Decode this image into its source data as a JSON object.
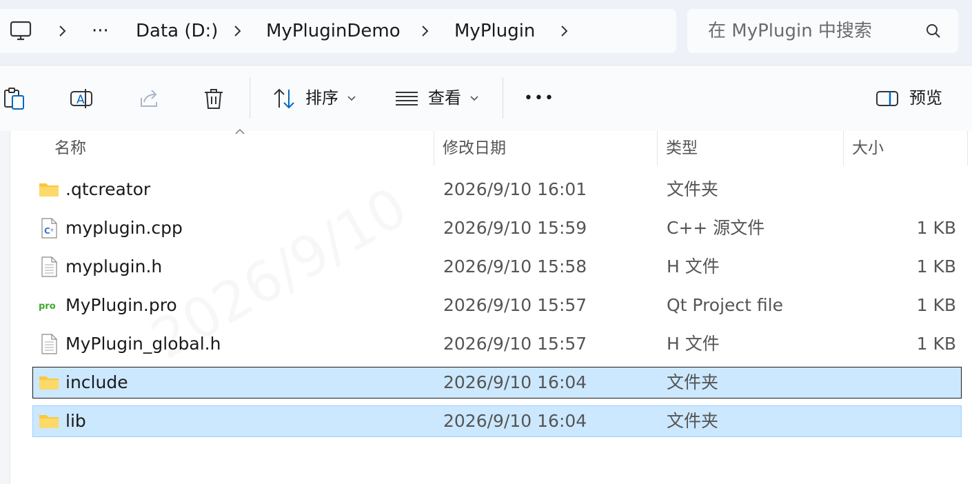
{
  "address_bar": {
    "overflow": "···",
    "crumbs": [
      "Data (D:)",
      "MyPluginDemo",
      "MyPlugin"
    ]
  },
  "search": {
    "placeholder": "在 MyPlugin 中搜索"
  },
  "toolbar": {
    "sort_label": "排序",
    "view_label": "查看",
    "more_label": "•••",
    "preview_label": "预览"
  },
  "columns": {
    "name": "名称",
    "date": "修改日期",
    "type": "类型",
    "size": "大小"
  },
  "files": [
    {
      "name": ".qtcreator",
      "date": "2026/9/10 16:01",
      "type": "文件夹",
      "size": "",
      "icon": "folder-icon"
    },
    {
      "name": "myplugin.cpp",
      "date": "2026/9/10 15:59",
      "type": "C++ 源文件",
      "size": "1 KB",
      "icon": "cpp-file-icon"
    },
    {
      "name": "myplugin.h",
      "date": "2026/9/10 15:58",
      "type": "H 文件",
      "size": "1 KB",
      "icon": "text-file-icon"
    },
    {
      "name": "MyPlugin.pro",
      "date": "2026/9/10 15:57",
      "type": "Qt Project file",
      "size": "1 KB",
      "icon": "pro-file-icon"
    },
    {
      "name": "MyPlugin_global.h",
      "date": "2026/9/10 15:57",
      "type": "H 文件",
      "size": "1 KB",
      "icon": "text-file-icon"
    },
    {
      "name": "include",
      "date": "2026/9/10 16:04",
      "type": "文件夹",
      "size": "",
      "icon": "folder-icon",
      "selected": true
    },
    {
      "name": "lib",
      "date": "2026/9/10 16:04",
      "type": "文件夹",
      "size": "",
      "icon": "folder-icon",
      "selected": true
    }
  ],
  "colors": {
    "selection": "#cce8ff",
    "selection_border": "#99d1ff",
    "folder": "#f9c93c",
    "accent": "#0067c0"
  }
}
